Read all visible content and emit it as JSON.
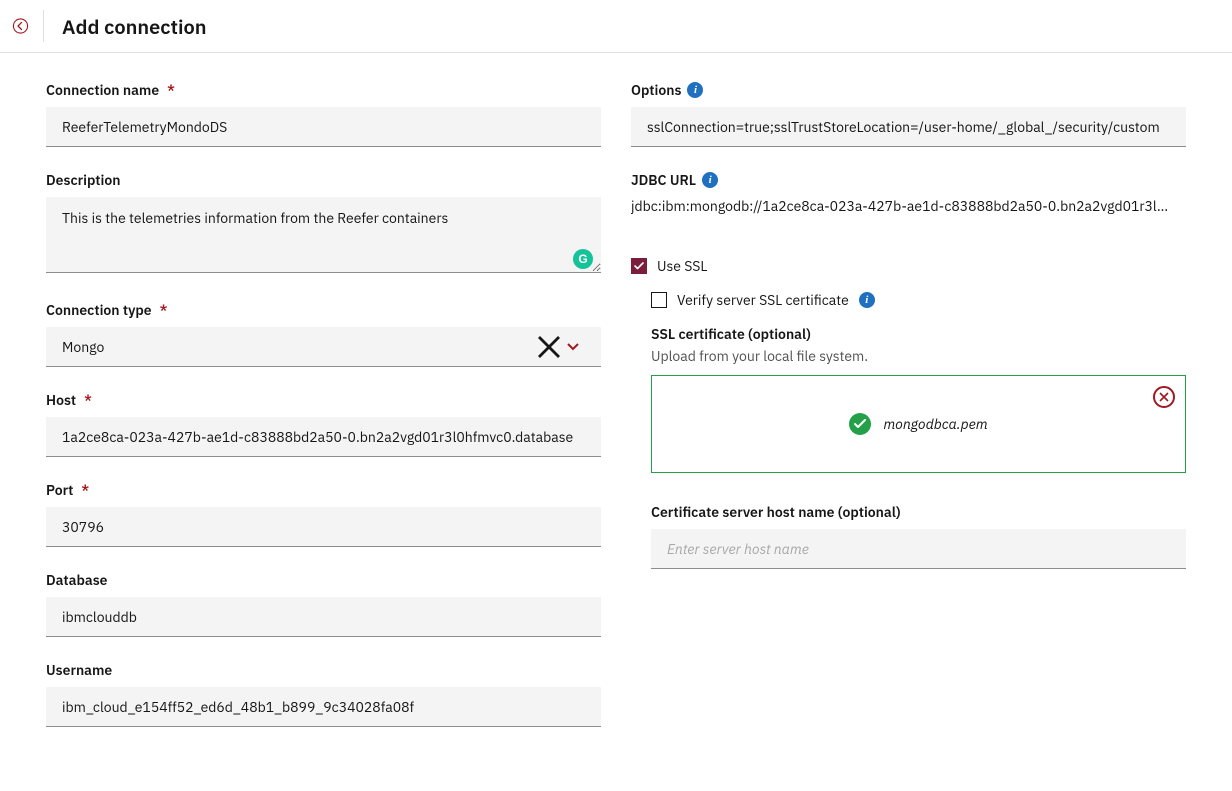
{
  "header": {
    "title": "Add connection"
  },
  "left": {
    "connection_name": {
      "label": "Connection name",
      "value": "ReeferTelemetryMondoDS"
    },
    "description": {
      "label": "Description",
      "value": "This is the telemetries information from the Reefer containers"
    },
    "connection_type": {
      "label": "Connection type",
      "value": "Mongo"
    },
    "host": {
      "label": "Host",
      "value": "1a2ce8ca-023a-427b-ae1d-c83888bd2a50-0.bn2a2vgd01r3l0hfmvc0.database"
    },
    "port": {
      "label": "Port",
      "value": "30796"
    },
    "database": {
      "label": "Database",
      "value": "ibmclouddb"
    },
    "username": {
      "label": "Username",
      "value": "ibm_cloud_e154ff52_ed6d_48b1_b899_9c34028fa08f"
    }
  },
  "right": {
    "options": {
      "label": "Options",
      "value": "sslConnection=true;sslTrustStoreLocation=/user-home/_global_/security/custom"
    },
    "jdbc": {
      "label": "JDBC URL",
      "value": "jdbc:ibm:mongodb://1a2ce8ca-023a-427b-ae1d-c83888bd2a50-0.bn2a2vgd01r3l…"
    },
    "use_ssl": {
      "label": "Use SSL",
      "checked": true
    },
    "verify_ssl": {
      "label": "Verify server SSL certificate",
      "checked": false
    },
    "ssl_cert": {
      "heading": "SSL certificate (optional)",
      "help": "Upload from your local file system.",
      "filename": "mongodbca.pem"
    },
    "cert_host": {
      "label": "Certificate server host name (optional)",
      "placeholder": "Enter server host name",
      "value": ""
    }
  },
  "colors": {
    "accent": "#7a1e3c",
    "danger": "#a2191f",
    "success": "#24a148",
    "info": "#1f70c1"
  }
}
